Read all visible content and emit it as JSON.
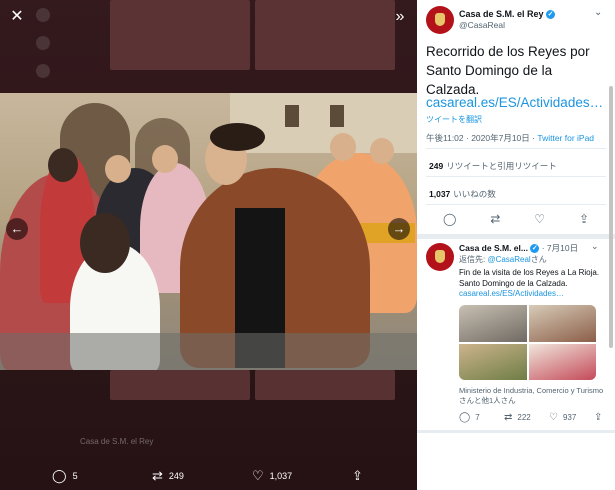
{
  "viewer": {
    "close_icon": "close-icon",
    "expand_icon": "double-chevron-right-icon",
    "bottom_bar": {
      "replies": "5",
      "retweets": "249",
      "likes": "1,037"
    },
    "ghost_tweet": "Casa de S.M. el Rey"
  },
  "tweet": {
    "account_name": "Casa de S.M. el Rey",
    "handle": "@CasaReal",
    "text": "Recorrido de los Reyes por Santo Domingo de la Calzada.",
    "link": "casareal.es/ES/Actividades…",
    "translate": "ツイートを翻訳",
    "time": "午後11:02 · 2020年7月10日 · ",
    "source": "Twitter for iPad",
    "retweet_count": "249",
    "retweet_label": "リツイートと引用リツイート",
    "like_count": "1,037",
    "like_label": "いいねの数"
  },
  "reply": {
    "account_name": "Casa de S.M. el...",
    "date": "· 7月10日",
    "reply_prefix": "返信先: ",
    "reply_to": "@CasaReal",
    "reply_suffix": "さん",
    "text": "Fin de la visita de los Reyes a La Rioja. Santo Domingo de la Calzada.",
    "link": "casareal.es/ES/Actividades…",
    "caption": "Ministerio de Industria, Comercio y Turismoさんと他1人さん",
    "replies": "7",
    "retweets": "222",
    "likes": "937"
  },
  "colors": {
    "link": "#1b95e0",
    "verified": "#1d9bf0",
    "avatar": "#b3121a"
  }
}
